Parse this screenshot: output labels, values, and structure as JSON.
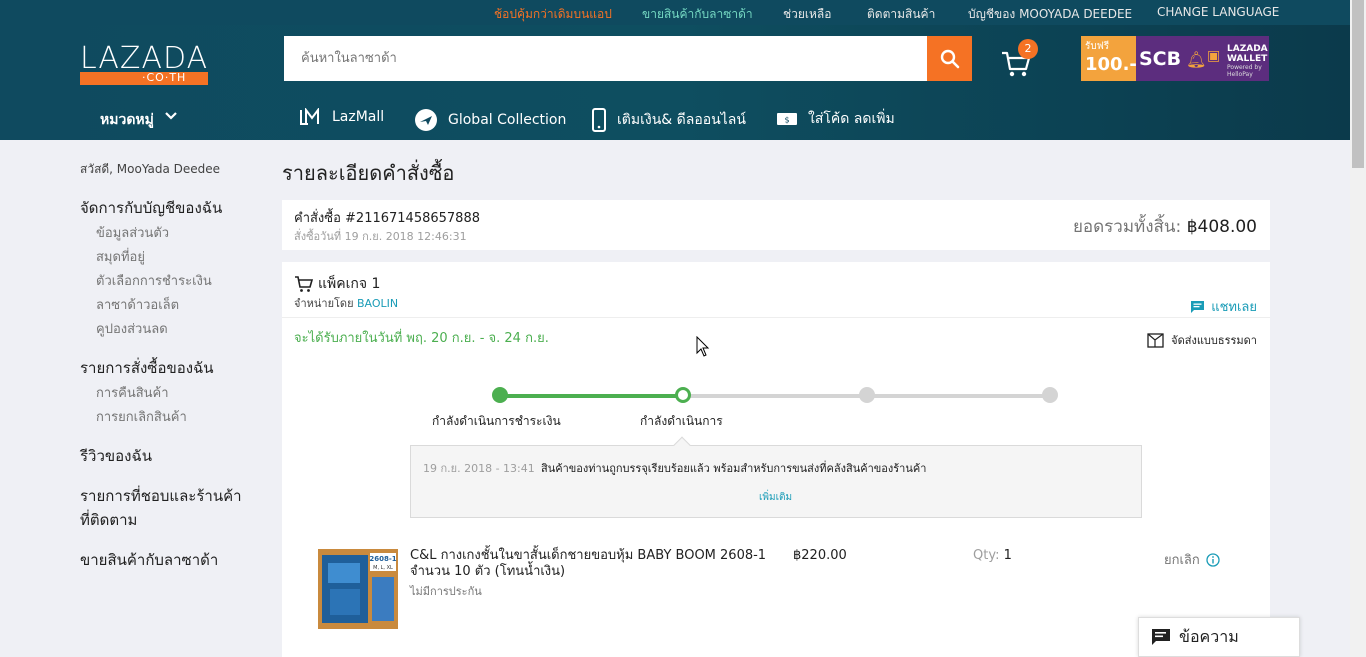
{
  "topbar": {
    "links": [
      {
        "label": "ช้อปคุ้มกว่าเดิมบนแอป",
        "color": "#f57224"
      },
      {
        "label": "ขายสินค้ากับลาซาด้า",
        "color": "#74d7c2"
      },
      {
        "label": "ช่วยเหลือ",
        "color": "#e8e8e8"
      },
      {
        "label": "ติดตามสินค้า",
        "color": "#e8e8e8"
      },
      {
        "label": "บัญชีของ MOOYADA DEEDEE",
        "color": "#e8e8e8"
      },
      {
        "label": "CHANGE LANGUAGE",
        "color": "#e8e8e8"
      }
    ]
  },
  "header": {
    "logo_text": "LAZADA",
    "logo_sub": "·CO·TH",
    "search_placeholder": "ค้นหาในลาซาด้า",
    "search_icon": "search-icon",
    "cart_count": "2",
    "promo": {
      "line1": "รับฟรี",
      "line2": "100.-",
      "bank": "SCB",
      "wallet": "LAZADA WALLET",
      "powered": "Powered by HelloPay"
    }
  },
  "nav": {
    "category_label": "หมวดหมู่",
    "items": [
      {
        "label": "LazMall",
        "icon": "lazmall-icon"
      },
      {
        "label": "Global Collection",
        "icon": "airplane-icon"
      },
      {
        "label": "เติมเงิน& ดีลออนไลน์",
        "icon": "mobile-phone-icon"
      },
      {
        "label": "ใส่โค้ด ลดเพิ่ม",
        "icon": "voucher-icon"
      }
    ]
  },
  "sidebar": {
    "greeting": "สวัสดี, MooYada Deedee",
    "sections": [
      {
        "title": "จัดการกับบัญชีของฉัน",
        "items": [
          "ข้อมูลส่วนตัว",
          "สมุดที่อยู่",
          "ตัวเลือกการชำระเงิน",
          "ลาซาด้าวอเล็ต",
          "คูปองส่วนลด"
        ]
      },
      {
        "title": "รายการสั่งซื้อของฉัน",
        "items": [
          "การคืนสินค้า",
          "การยกเลิกสินค้า"
        ]
      },
      {
        "title": "รีวิวของฉัน",
        "items": []
      },
      {
        "title": "รายการที่ชอบและร้านค้าที่ติดตาม",
        "items": []
      },
      {
        "title": "ขายสินค้ากับลาซาด้า",
        "items": []
      }
    ]
  },
  "main": {
    "title": "รายละเอียดคำสั่งซื้อ",
    "order": {
      "number": "คำสั่งซื้อ #211671458657888",
      "date": "สั่งซื้อวันที่ 19 ก.ย. 2018 12:46:31",
      "total_label": "ยอดรวมทั้งสิ้น:",
      "total_value": "฿408.00"
    },
    "package": {
      "title": "แพ็คเกจ 1",
      "seller_prefix": "จำหน่ายโดย",
      "seller": "BAOLIN",
      "chat": "แชทเลย",
      "eta": "จะได้รับภายในวันที่ พฤ. 20 ก.ย. - จ. 24 ก.ย.",
      "ship_mode": "จัดส่งแบบธรรมดา",
      "progress_fraction": 0.333,
      "steps": [
        "กำลังดำเนินการชำระเงิน",
        "กำลังดำเนินการ",
        "",
        ""
      ],
      "status_time": "19 ก.ย. 2018 - 13:41",
      "status_text": "สินค้าของท่านถูกบรรจุเรียบร้อยแล้ว พร้อมสำหรับการขนส่งที่คลังสินค้าของร้านค้า",
      "status_more": "เพิ่มเติม",
      "item": {
        "name": "C&L กางเกงชั้นในขาสั้นเด็กชายขอบหุ้ม BABY BOOM 2608-1 จำนวน 10 ตัว (โทนน้ำเงิน)",
        "warranty": "ไม่มีการประกัน",
        "price": "฿220.00",
        "qty_label": "Qty:",
        "qty_value": "1",
        "cancel": "ยกเลิก",
        "thumb_label": "2608-1",
        "thumb_sizes": "M, L, XL"
      }
    }
  },
  "chat_widget": {
    "label": "ข้อความ"
  },
  "colors": {
    "accent": "#f57224",
    "header": "#0f4a5f",
    "link": "#1a9cb7",
    "success": "#4caf50"
  }
}
